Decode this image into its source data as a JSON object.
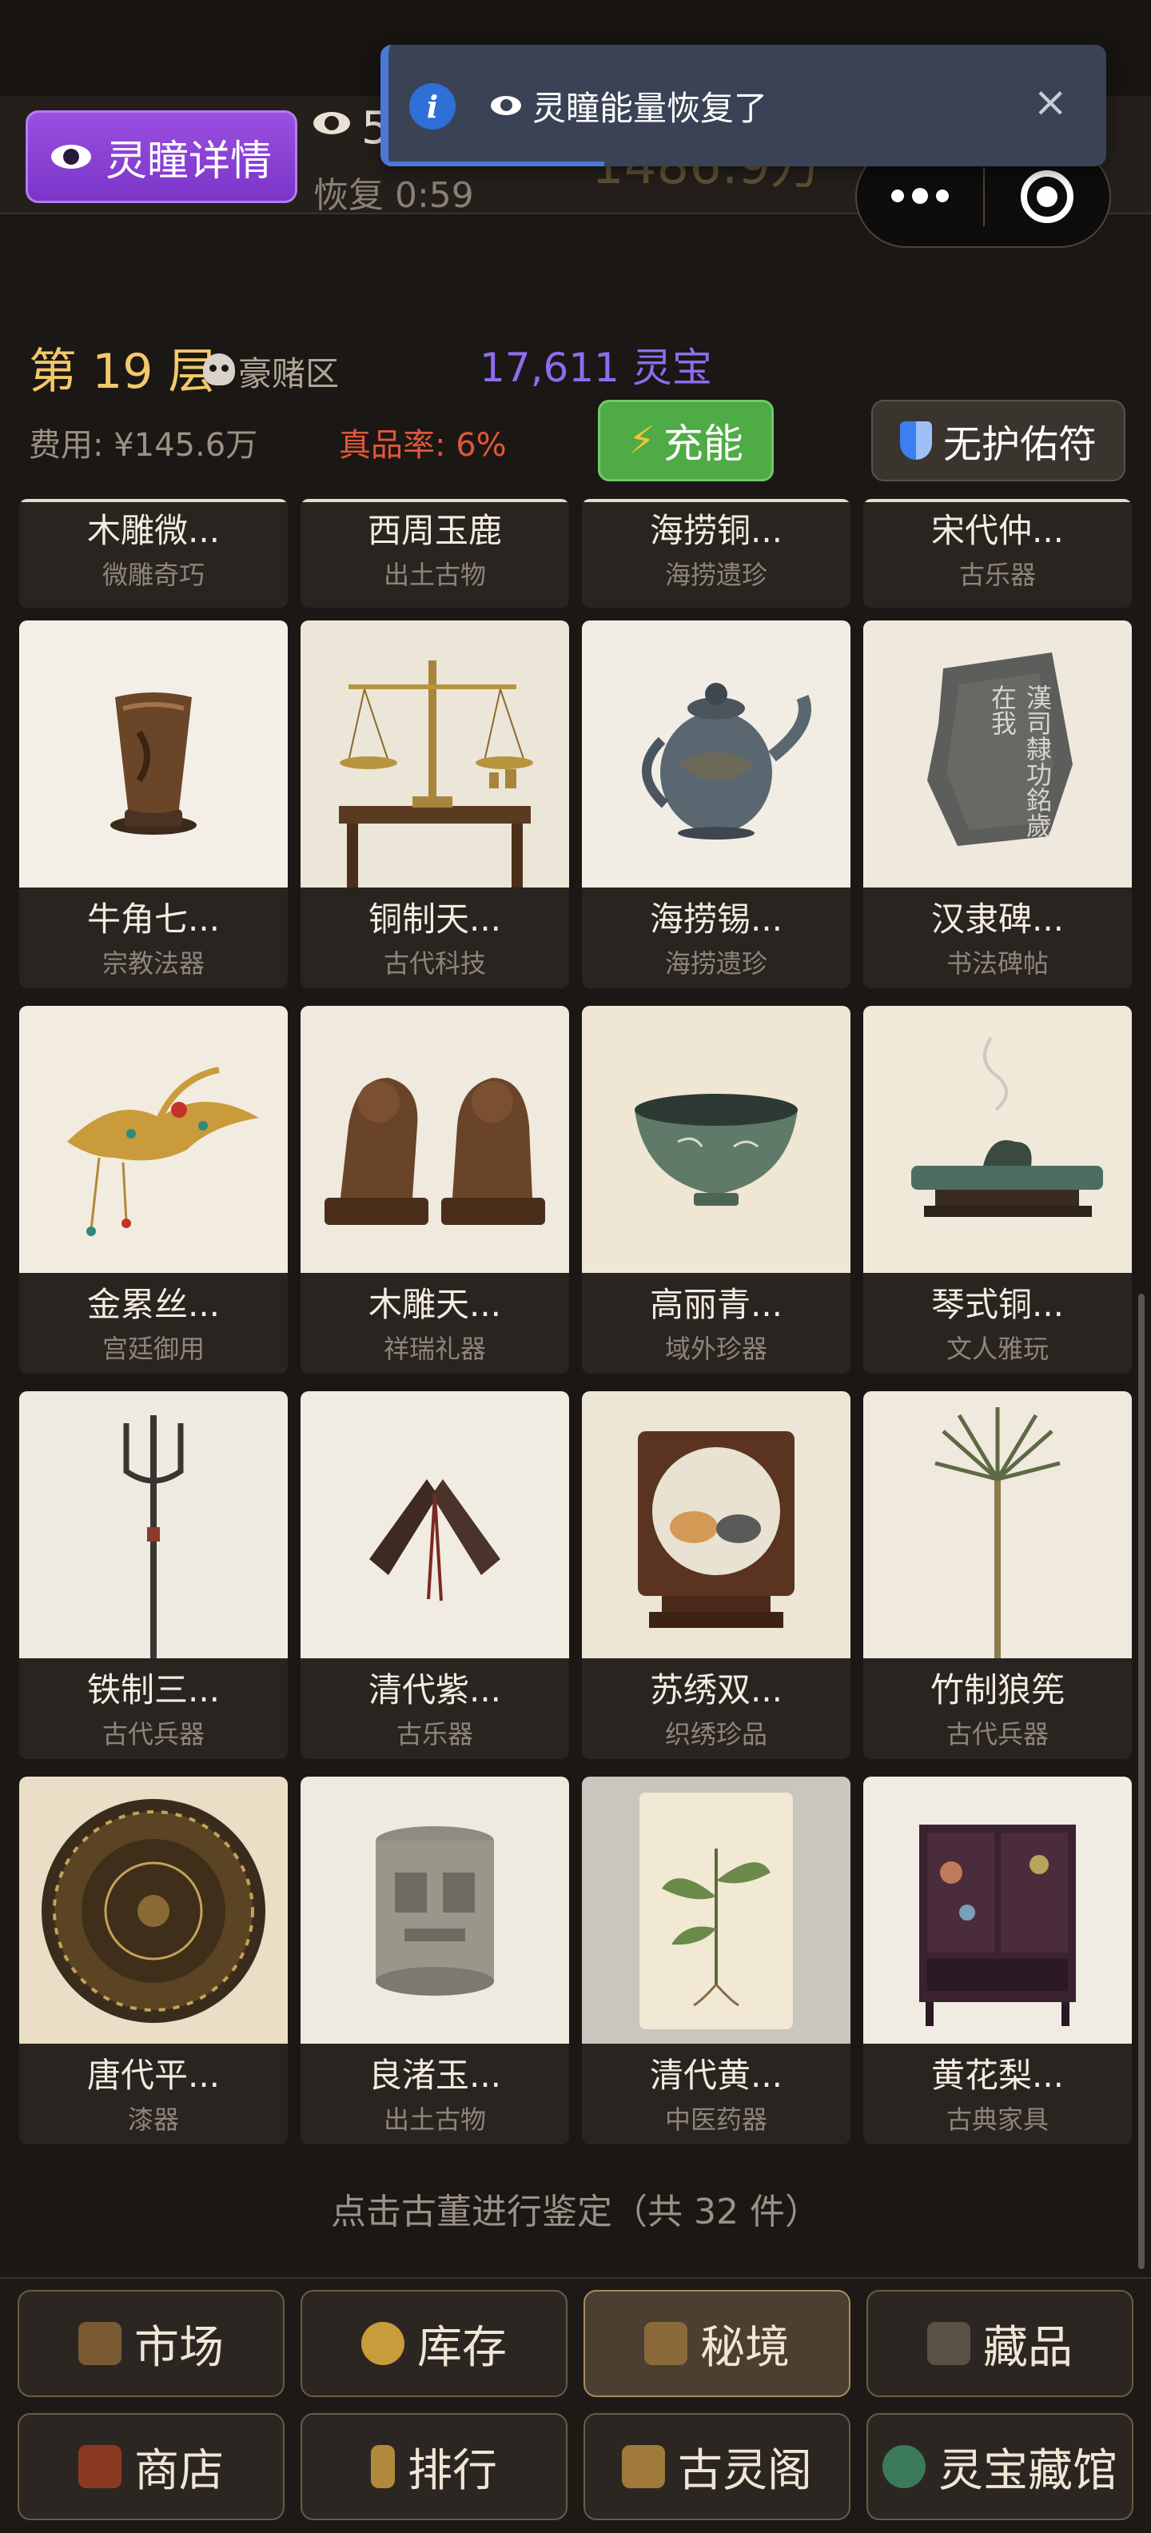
{
  "header": {
    "detail_button": "灵瞳详情",
    "energy_count": "5",
    "recover_label": "恢复 0:59",
    "money_ghost": "1486.9万"
  },
  "toast": {
    "message": "灵瞳能量恢复了",
    "close": "×"
  },
  "floor": {
    "title": "第 19 层",
    "zone": "豪赌区",
    "lingbao": "17,611 灵宝",
    "cost": "费用: ¥145.6万",
    "rate": "真品率: 6%",
    "charge_button": "充能",
    "shield_button": "无护佑符"
  },
  "partial_items": [
    {
      "name": "木雕微...",
      "category": "微雕奇巧"
    },
    {
      "name": "西周玉鹿",
      "category": "出土古物"
    },
    {
      "name": "海捞铜...",
      "category": "海捞遗珍"
    },
    {
      "name": "宋代仲...",
      "category": "古乐器"
    }
  ],
  "items": [
    {
      "name": "牛角七...",
      "category": "宗教法器",
      "icon": "horn-cup-icon"
    },
    {
      "name": "铜制天...",
      "category": "古代科技",
      "icon": "brass-scale-icon"
    },
    {
      "name": "海捞锡...",
      "category": "海捞遗珍",
      "icon": "tin-teapot-icon"
    },
    {
      "name": "汉隶碑...",
      "category": "书法碑帖",
      "icon": "stone-stele-icon",
      "stele_text": "漢司隸功銘歲在我"
    },
    {
      "name": "金累丝...",
      "category": "宫廷御用",
      "icon": "gold-phoenix-hairpin-icon"
    },
    {
      "name": "木雕天...",
      "category": "祥瑞礼器",
      "icon": "wooden-lions-icon"
    },
    {
      "name": "高丽青...",
      "category": "域外珍器",
      "icon": "celadon-bowl-icon"
    },
    {
      "name": "琴式铜...",
      "category": "文人雅玩",
      "icon": "qin-incense-burner-icon"
    },
    {
      "name": "铁制三...",
      "category": "古代兵器",
      "icon": "iron-trident-icon"
    },
    {
      "name": "清代紫...",
      "category": "古乐器",
      "icon": "wooden-clappers-icon"
    },
    {
      "name": "苏绣双...",
      "category": "织绣珍品",
      "icon": "embroidered-cat-screen-icon"
    },
    {
      "name": "竹制狼筅",
      "category": "古代兵器",
      "icon": "bamboo-langxian-icon"
    },
    {
      "name": "唐代平...",
      "category": "漆器",
      "icon": "bronze-mirror-icon"
    },
    {
      "name": "良渚玉...",
      "category": "出土古物",
      "icon": "jade-cong-icon"
    },
    {
      "name": "清代黄...",
      "category": "中医药器",
      "icon": "herbal-painting-icon"
    },
    {
      "name": "黄花梨...",
      "category": "古典家具",
      "icon": "lacquer-cabinet-icon"
    }
  ],
  "footer": "点击古董进行鉴定（共 32 件）",
  "nav": [
    {
      "label": "市场",
      "icon": "market-icon"
    },
    {
      "label": "库存",
      "icon": "inventory-icon"
    },
    {
      "label": "秘境",
      "icon": "secret-realm-icon",
      "active": true
    },
    {
      "label": "藏品",
      "icon": "collection-icon"
    },
    {
      "label": "商店",
      "icon": "shop-icon"
    },
    {
      "label": "排行",
      "icon": "ranking-icon"
    },
    {
      "label": "古灵阁",
      "icon": "guling-pavilion-icon"
    },
    {
      "label": "灵宝藏馆",
      "icon": "lingbao-museum-icon"
    }
  ]
}
